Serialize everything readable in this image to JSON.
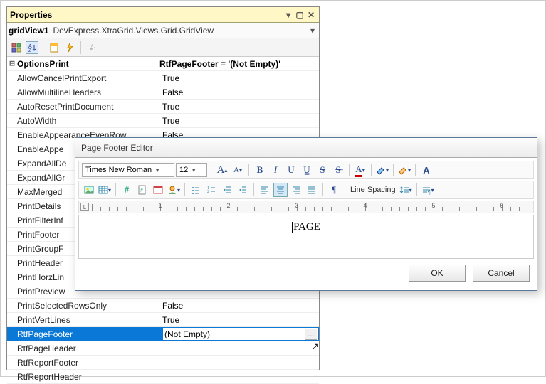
{
  "panel": {
    "title": "Properties",
    "object_name": "gridView1",
    "object_type": "DevExpress.XtraGrid.Views.Grid.GridView"
  },
  "category": {
    "name": "OptionsPrint",
    "summary": "RtfPageFooter = '(Not Empty)'"
  },
  "props": [
    {
      "label": "AllowCancelPrintExport",
      "value": "True"
    },
    {
      "label": "AllowMultilineHeaders",
      "value": "False"
    },
    {
      "label": "AutoResetPrintDocument",
      "value": "True"
    },
    {
      "label": "AutoWidth",
      "value": "True"
    },
    {
      "label": "EnableAppearanceEvenRow",
      "value": "False"
    },
    {
      "label": "EnableAppe",
      "value": ""
    },
    {
      "label": "ExpandAllDe",
      "value": ""
    },
    {
      "label": "ExpandAllGr",
      "value": ""
    },
    {
      "label": "MaxMerged",
      "value": ""
    },
    {
      "label": "PrintDetails",
      "value": ""
    },
    {
      "label": "PrintFilterInf",
      "value": ""
    },
    {
      "label": "PrintFooter",
      "value": ""
    },
    {
      "label": "PrintGroupF",
      "value": ""
    },
    {
      "label": "PrintHeader",
      "value": ""
    },
    {
      "label": "PrintHorzLin",
      "value": ""
    },
    {
      "label": "PrintPreview",
      "value": ""
    },
    {
      "label": "PrintSelectedRowsOnly",
      "value": "False"
    },
    {
      "label": "PrintVertLines",
      "value": "True"
    },
    {
      "label": "RtfPageFooter",
      "value": "(Not Empty)",
      "selected": true
    },
    {
      "label": "RtfPageHeader",
      "value": ""
    },
    {
      "label": "RtfReportFooter",
      "value": ""
    },
    {
      "label": "RtfReportHeader",
      "value": ""
    }
  ],
  "dialog": {
    "title": "Page Footer Editor",
    "font_name": "Times New Roman",
    "font_size": "12",
    "line_spacing_label": "Line Spacing",
    "content": "PAGE",
    "ok": "OK",
    "cancel": "Cancel"
  },
  "ruler": {
    "labels": [
      "1",
      "2",
      "3",
      "4",
      "5",
      "6"
    ]
  }
}
